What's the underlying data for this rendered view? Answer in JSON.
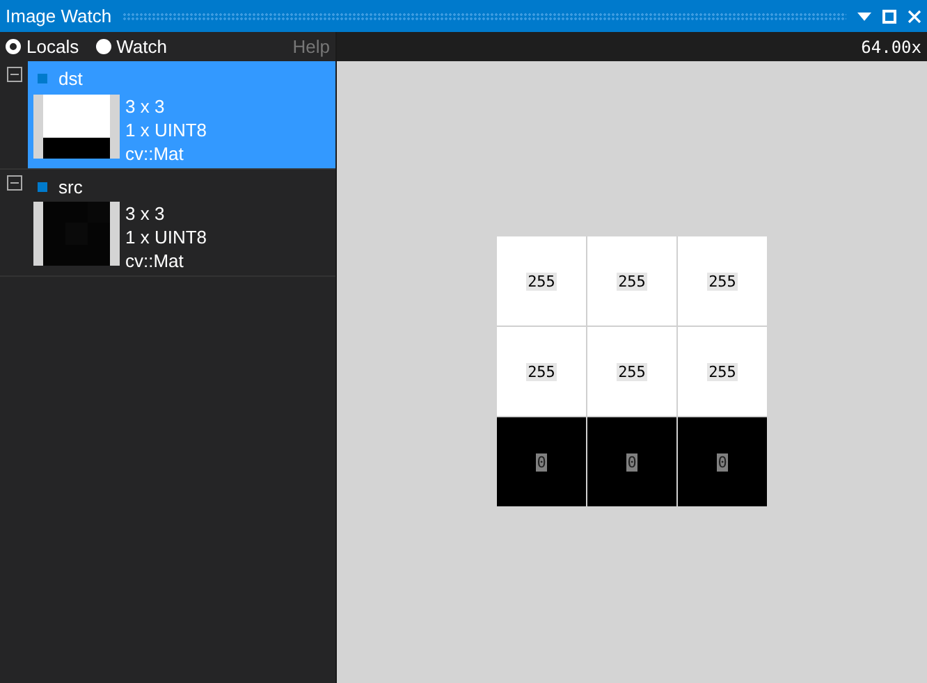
{
  "window": {
    "title": "Image Watch"
  },
  "toolbar": {
    "modes": [
      {
        "label": "Locals",
        "selected": true
      },
      {
        "label": "Watch",
        "selected": false
      }
    ],
    "help": "Help",
    "zoom": "64.00x"
  },
  "items": [
    {
      "name": "dst",
      "selected": true,
      "expanded": true,
      "kind": "split",
      "size": "3 x 3",
      "channels": "1 x UINT8",
      "type": "cv::Mat"
    },
    {
      "name": "src",
      "selected": false,
      "expanded": true,
      "kind": "dark",
      "size": "3 x 3",
      "channels": "1 x UINT8",
      "type": "cv::Mat"
    }
  ],
  "pixels": [
    [
      {
        "value": "255",
        "color": "#ffffff"
      },
      {
        "value": "255",
        "color": "#ffffff"
      },
      {
        "value": "255",
        "color": "#ffffff"
      }
    ],
    [
      {
        "value": "255",
        "color": "#ffffff"
      },
      {
        "value": "255",
        "color": "#ffffff"
      },
      {
        "value": "255",
        "color": "#ffffff"
      }
    ],
    [
      {
        "value": "0",
        "color": "#000000"
      },
      {
        "value": "0",
        "color": "#000000"
      },
      {
        "value": "0",
        "color": "#000000"
      }
    ]
  ]
}
